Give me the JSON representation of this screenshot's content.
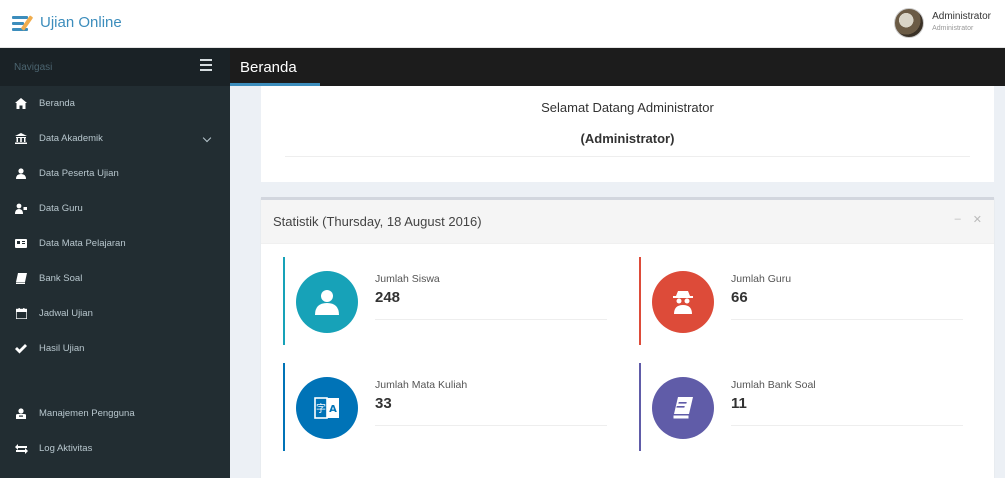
{
  "app": {
    "title": "Ujian Online"
  },
  "user": {
    "name": "Administrator",
    "role": "Administrator"
  },
  "sidebar": {
    "nav_label": "Navigasi",
    "items": [
      {
        "label": "Beranda",
        "icon": "home-icon"
      },
      {
        "label": "Data Akademik",
        "icon": "institution-icon",
        "has_submenu": true
      },
      {
        "label": "Data Peserta Ujian",
        "icon": "user-icon"
      },
      {
        "label": "Data Guru",
        "icon": "teacher-icon"
      },
      {
        "label": "Data Mata Pelajaran",
        "icon": "book-icon"
      },
      {
        "label": "Bank Soal",
        "icon": "book-bank-icon"
      },
      {
        "label": "Jadwal Ujian",
        "icon": "calendar-icon"
      },
      {
        "label": "Hasil Ujian",
        "icon": "check-icon"
      },
      {
        "label": "Manajemen Pengguna",
        "icon": "user-admin-icon"
      },
      {
        "label": "Log Aktivitas",
        "icon": "exchange-icon"
      }
    ]
  },
  "content": {
    "title": "Beranda"
  },
  "welcome": {
    "line1": "Selamat Datang Administrator",
    "line2": "(Administrator)"
  },
  "stats": {
    "title": "Statistik (Thursday, 18 August 2016)",
    "cards": [
      {
        "label": "Jumlah Siswa",
        "value": "248",
        "color": "#17a2b8",
        "icon": "user-icon"
      },
      {
        "label": "Jumlah Guru",
        "value": "66",
        "color": "#dd4b39",
        "icon": "spy-icon"
      },
      {
        "label": "Jumlah Mata Kuliah",
        "value": "33",
        "color": "#0073b7",
        "icon": "language-icon"
      },
      {
        "label": "Jumlah Bank Soal",
        "value": "11",
        "color": "#605ca8",
        "icon": "book-icon"
      }
    ]
  },
  "colors": {
    "accent": "#3c8dbc",
    "sidebar_bg": "#222d32",
    "header_dark": "#1c1c1c"
  }
}
